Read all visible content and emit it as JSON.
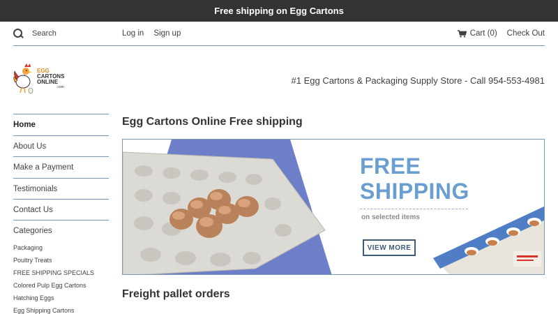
{
  "announcement": {
    "text": "Free shipping on Egg Cartons"
  },
  "topbar": {
    "search_placeholder": "Search",
    "login": "Log in",
    "signup": "Sign up",
    "cart": "Cart (0)",
    "checkout": "Check Out"
  },
  "header": {
    "logo_text": "EGG CARTONS ONLINE .com",
    "tagline": "#1 Egg Cartons & Packaging Supply Store - Call 954-553-4981"
  },
  "sidebar": {
    "nav": [
      "Home",
      "About Us",
      "Make a Payment",
      "Testimonials",
      "Contact Us"
    ],
    "categories_heading": "Categories",
    "categories": [
      "Packaging",
      "Poultry Treats",
      "FREE SHIPPING SPECIALS",
      "Colored Pulp Egg Cartons",
      "Hatching Eggs",
      "Egg Shipping Cartons"
    ]
  },
  "main": {
    "title": "Egg Cartons Online Free shipping",
    "banner": {
      "line1": "FREE",
      "line2": "SHIPPING",
      "sub": "on selected items",
      "button": "VIEW MORE"
    },
    "section_title": "Freight pallet orders"
  },
  "colors": {
    "announce_bg": "#333333",
    "accent_blue": "#6a9ed0",
    "divider": "#7797b8",
    "banner_shape": "#6d7fc9"
  }
}
